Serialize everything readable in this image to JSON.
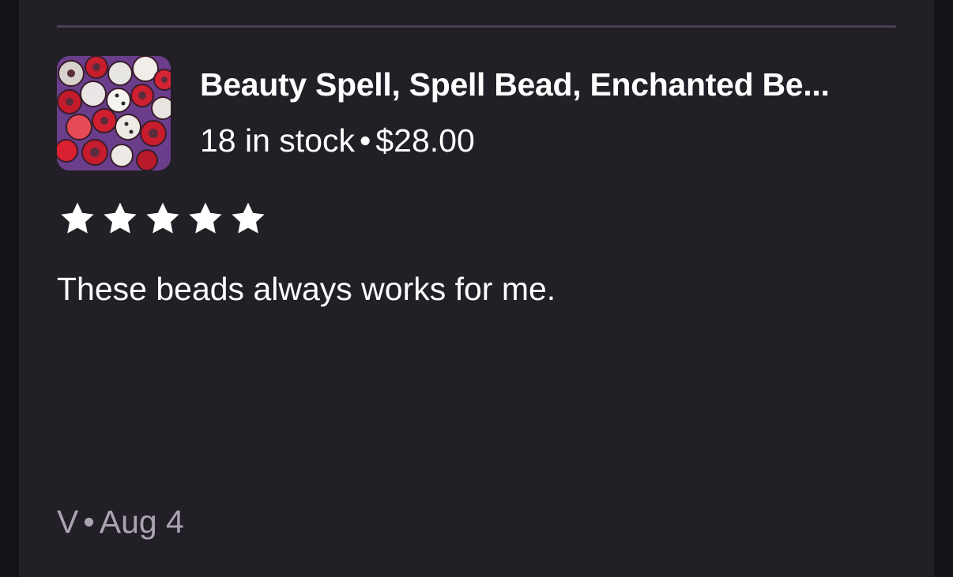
{
  "review": {
    "listing": {
      "title": "Beauty Spell, Spell Bead, Enchanted Be...",
      "stock": "18 in stock",
      "separator": "•",
      "price": "$28.00",
      "thumbnail_icon": "beads-photo"
    },
    "rating": 5,
    "rating_max": 5,
    "text": "These beads always works for me.",
    "reviewer": "V",
    "date": "Aug 4"
  },
  "colors": {
    "background": "#221f26",
    "divider": "#4a3f55",
    "text": "#ffffff",
    "muted_text": "#a9a4b0",
    "star": "#ffffff"
  }
}
